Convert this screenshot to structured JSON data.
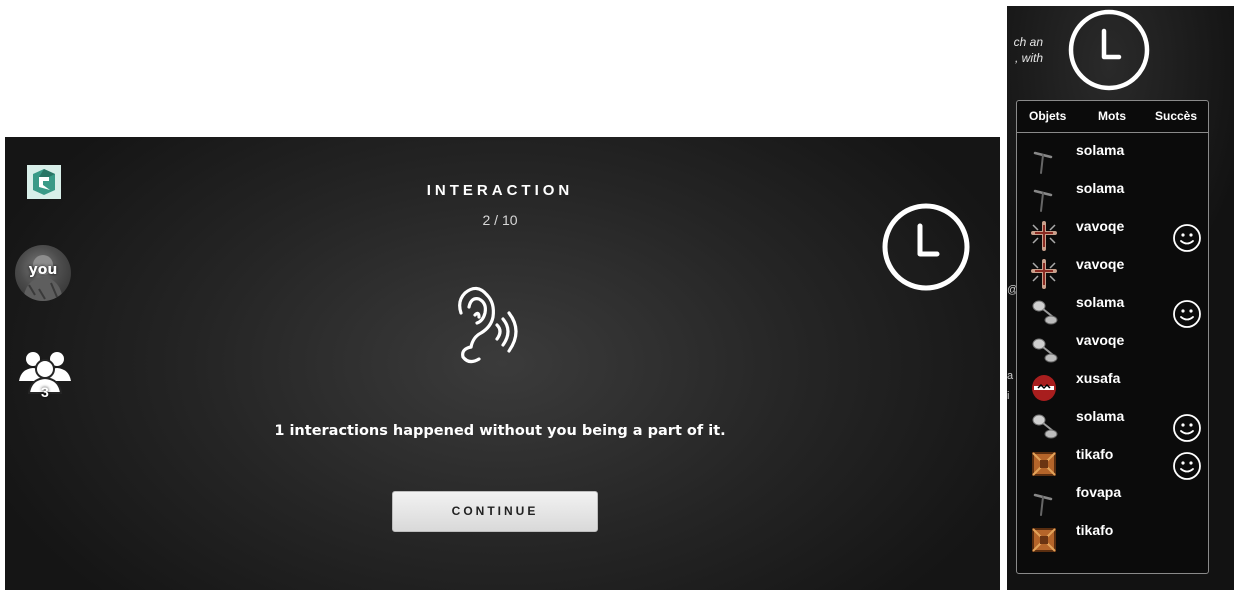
{
  "interaction": {
    "title": "INTERACTION",
    "counter": "2 / 10",
    "message": "1 interactions happened without you being a part of it.",
    "continue_label": "CONTINUE"
  },
  "player": {
    "avatar_label": "you",
    "group_count": "3"
  },
  "side_panel": {
    "cut_text_line1": "ch an",
    "cut_text_line2": ", with",
    "cut_fragment_1": "@",
    "cut_fragment_2": "a",
    "cut_fragment_3": "i",
    "tabs": [
      "Objets",
      "Mots",
      "Succès"
    ],
    "items": [
      {
        "word": "solama",
        "thumb": "stick-icon",
        "smiley": false
      },
      {
        "word": "solama",
        "thumb": "stick-icon",
        "smiley": false
      },
      {
        "word": "vavoqe",
        "thumb": "cross-icon",
        "smiley": true
      },
      {
        "word": "vavoqe",
        "thumb": "cross-icon",
        "smiley": false
      },
      {
        "word": "solama",
        "thumb": "spoon-icon",
        "smiley": true
      },
      {
        "word": "vavoqe",
        "thumb": "spoon-icon",
        "smiley": false
      },
      {
        "word": "xusafa",
        "thumb": "red-shield-icon",
        "smiley": false
      },
      {
        "word": "solama",
        "thumb": "spoon-icon",
        "smiley": true
      },
      {
        "word": "tikafo",
        "thumb": "tile-icon",
        "smiley": true
      },
      {
        "word": "fovapa",
        "thumb": "stick-icon",
        "smiley": false
      },
      {
        "word": "tikafo",
        "thumb": "tile-icon",
        "smiley": false
      }
    ]
  },
  "colors": {
    "panel_bg": "#252525",
    "text": "#ffffff",
    "button_bg": "#e6e6e6",
    "logo_bg": "#d8efe9",
    "logo_accent": "#3a9a87"
  }
}
